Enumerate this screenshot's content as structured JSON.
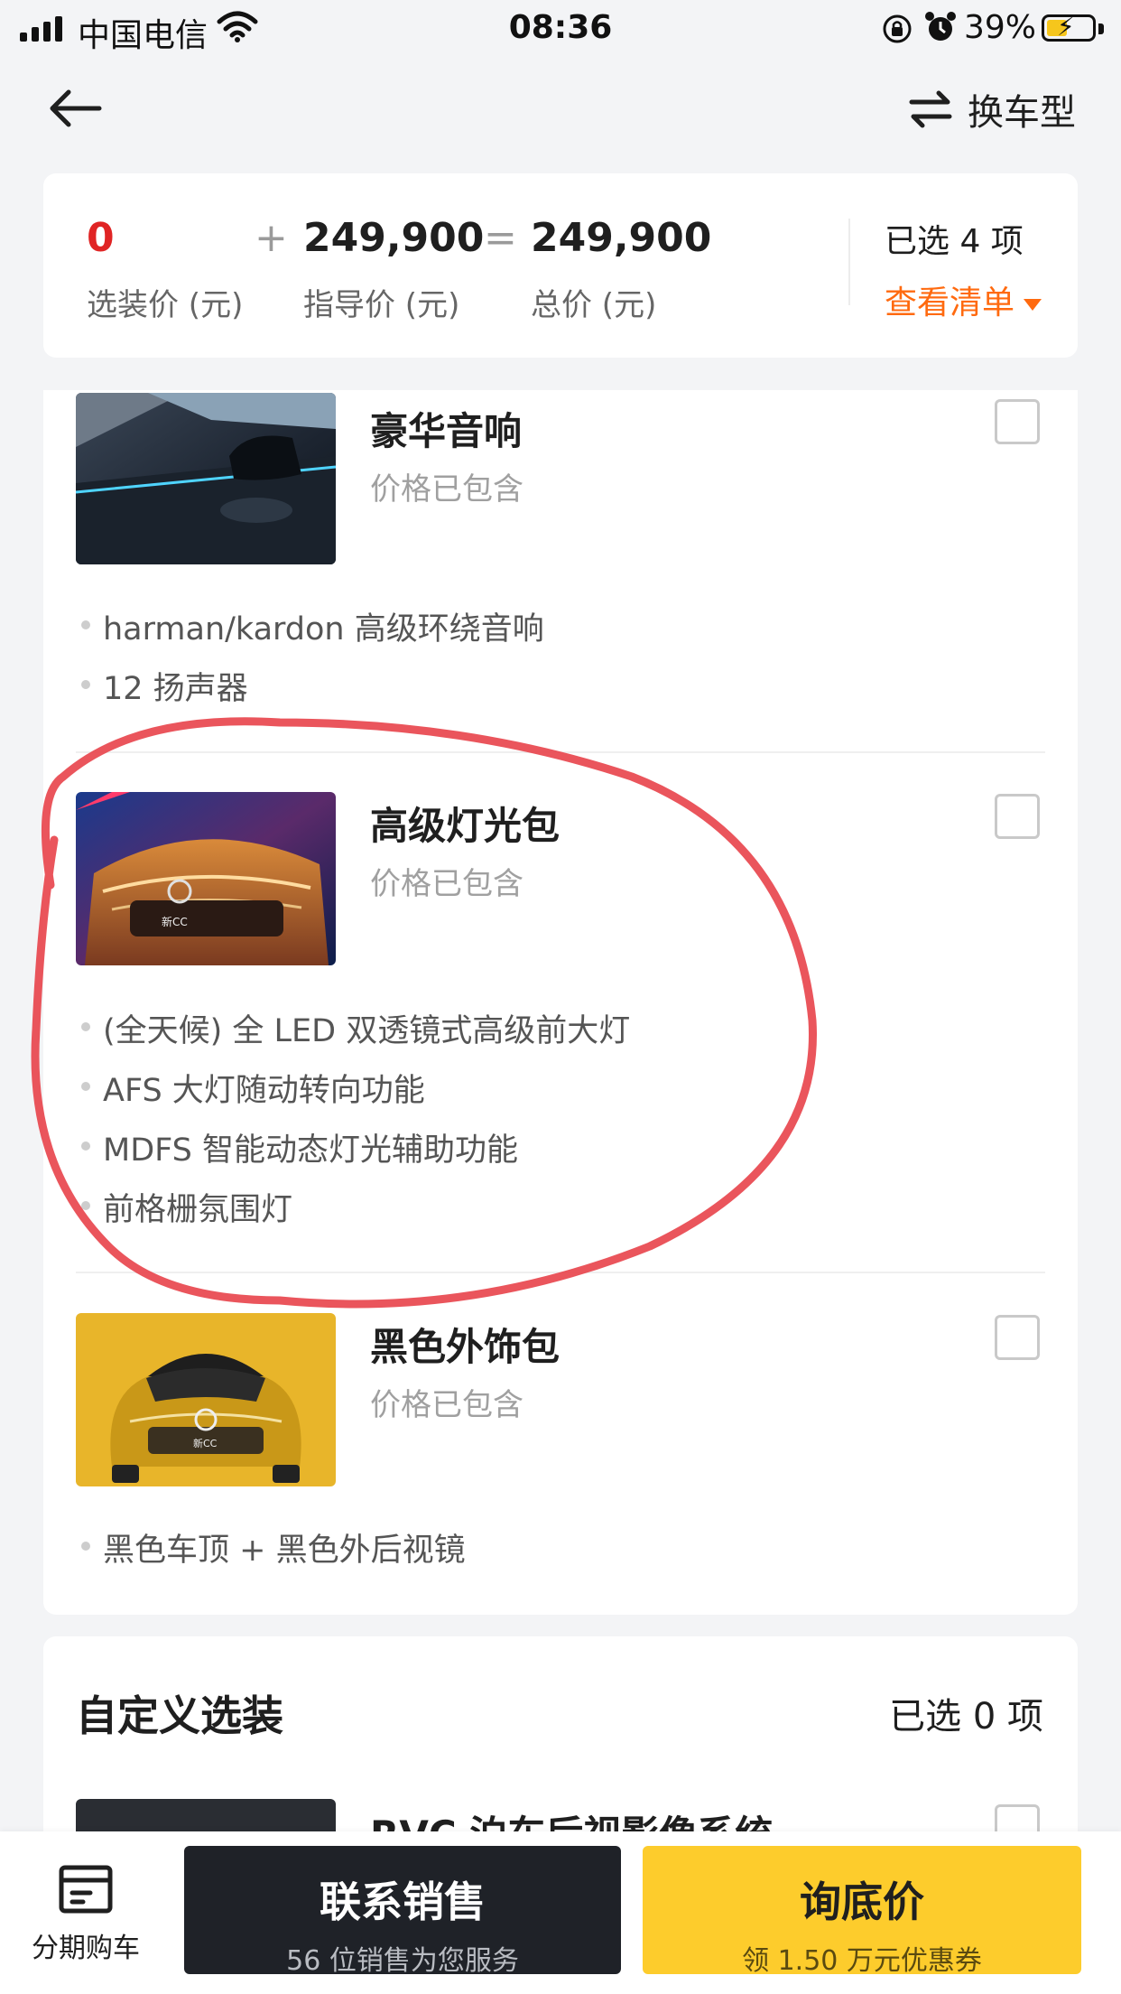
{
  "status_bar": {
    "carrier": "中国电信",
    "time": "08:36",
    "battery": "39%"
  },
  "nav": {
    "switch_label": "换车型",
    "icons": [
      "back-arrow-icon",
      "swap-icon"
    ]
  },
  "summary": {
    "option_price": "0",
    "option_price_label": "选装价 (元)",
    "op_plus": "+",
    "guide_price": "249,900",
    "guide_price_label": "指导价 (元)",
    "op_equals": "=",
    "total_price": "249,900",
    "total_price_label": "总价 (元)",
    "selected_count": "已选 4 项",
    "view_list": "查看清单"
  },
  "packages": [
    {
      "name": "豪华音响",
      "price": "价格已包含",
      "features": [
        "harman/kardon 高级环绕音响",
        "12 扬声器"
      ]
    },
    {
      "name": "高级灯光包",
      "price": "价格已包含",
      "features": [
        "(全天候) 全 LED 双透镜式高级前大灯",
        "AFS 大灯随动转向功能",
        "MDFS 智能动态灯光辅助功能",
        "前格栅氛围灯"
      ],
      "image_badge": "新CC"
    },
    {
      "name": "黑色外饰包",
      "price": "价格已包含",
      "features": [
        "黑色车顶 + 黑色外后视镜"
      ],
      "image_badge": "新CC"
    }
  ],
  "custom": {
    "title": "自定义选装",
    "count": "已选 0 项",
    "first_item": "RVC 泊车后视影像系统"
  },
  "bottom_bar": {
    "loan_label": "分期购车",
    "contact_label": "联系销售",
    "contact_sub": "56 位销售为您服务",
    "inquire_label": "询底价",
    "inquire_sub": "领 1.50 万元优惠券"
  },
  "colors": {
    "accent_orange": "#ff6a0f",
    "price_red": "#e02424",
    "cta_yellow": "#fdcc2c",
    "cta_dark": "#1f2228",
    "annotation_red": "#e8424a"
  }
}
